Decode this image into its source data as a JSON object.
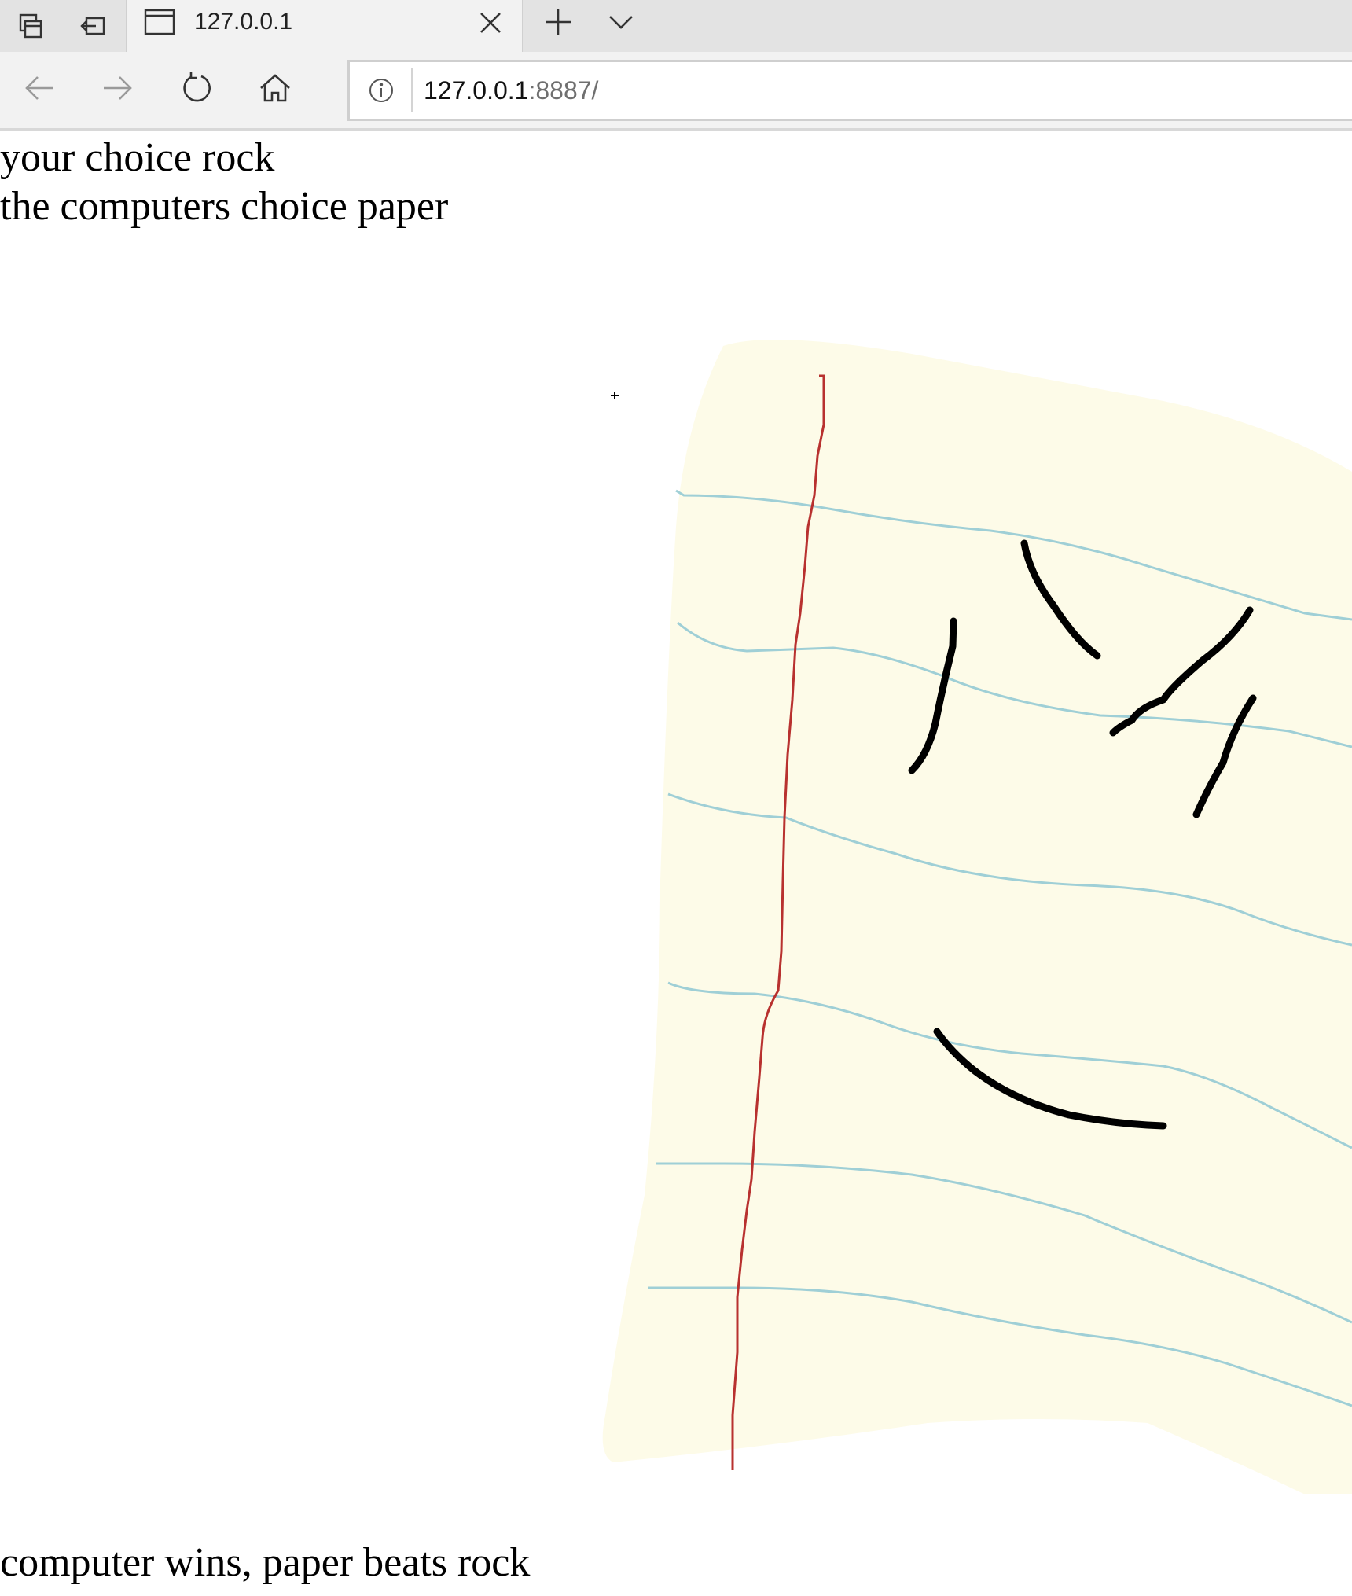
{
  "browser": {
    "tab": {
      "title": "127.0.0.1"
    },
    "address": {
      "host": "127.0.0.1",
      "path": ":8887/"
    }
  },
  "page": {
    "your_choice": "your choice rock",
    "computer_choice": "the computers choice paper",
    "result": "computer wins, paper beats rock",
    "image": {
      "description_icon": "paper-icon",
      "paper_color": "#fdfbe8",
      "margin_color": "#b8312f",
      "rule_color": "#9fcfd6"
    }
  }
}
